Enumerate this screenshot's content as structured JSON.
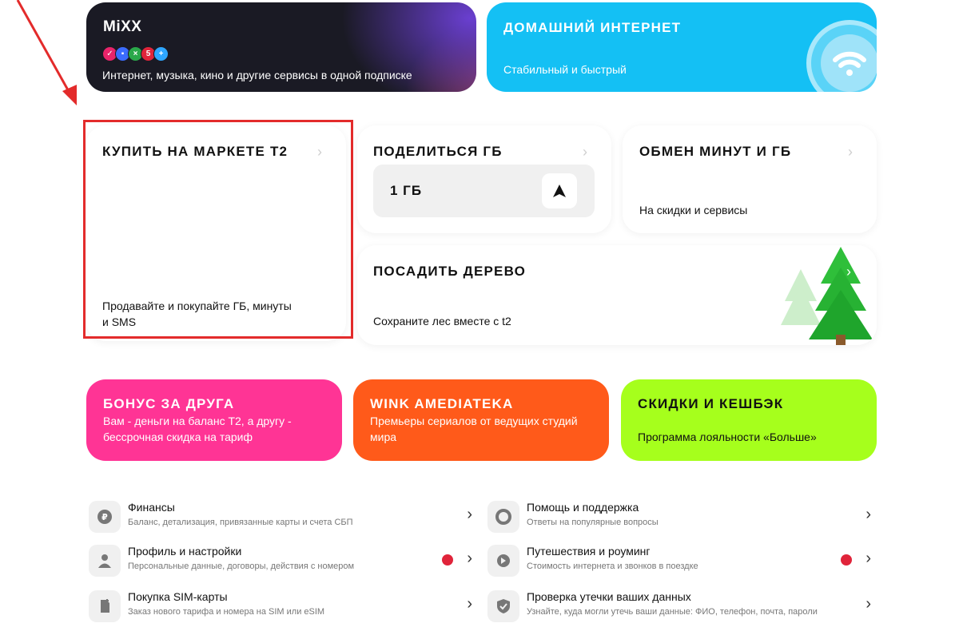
{
  "colors": {
    "accent_red": "#e32b2b",
    "home_blue": "#14c0f4",
    "bonus_pink": "#ff3495",
    "wink_orange": "#ff5a1a",
    "cashback_green": "#a6ff1c",
    "badge_red": "#e0243a"
  },
  "mixx": {
    "title": "MiXX",
    "subtitle": "Интернет, музыка, кино и другие сервисы в одной подписке",
    "service_icons": [
      "kion-icon",
      "okko-icon",
      "game-icon",
      "five-icon",
      "plus-icon"
    ]
  },
  "home_internet": {
    "title": "ДОМАШНИЙ ИНТЕРНЕТ",
    "subtitle": "Стабильный и быстрый",
    "icon": "wifi-icon"
  },
  "market": {
    "title": "КУПИТЬ НА МАРКЕТЕ t2",
    "subtitle_line1": "Продавайте и покупайте ГБ, минуты",
    "subtitle_line2": "и SMS"
  },
  "share": {
    "title": "ПОДЕЛИТЬСЯ ГБ",
    "amount": "1 ГБ"
  },
  "exchange": {
    "title": "ОБМЕН МИНУТ И ГБ",
    "subtitle": "На скидки и сервисы"
  },
  "tree": {
    "title": "ПОСАДИТЬ ДЕРЕВО",
    "subtitle": "Сохраните лес вместе с t2"
  },
  "bonus": {
    "title": "БОНУС ЗА ДРУГА",
    "line1": "Вам - деньги на баланс Т2, а другу -",
    "line2": "бессрочная скидка на тариф"
  },
  "wink": {
    "title": "WINK AMEDIATEKA",
    "line1": "Премьеры сериалов от ведущих студий",
    "line2": "мира"
  },
  "cashback": {
    "title": "СКИДКИ И КЕШБЭК",
    "subtitle": "Программа лояльности «Больше»"
  },
  "menu": [
    {
      "title": "Финансы",
      "subtitle": "Баланс, детализация, привязанные карты и счета СБП",
      "icon": "ruble-icon"
    },
    {
      "title": "Помощь и поддержка",
      "subtitle": "Ответы на популярные вопросы",
      "icon": "lifebuoy-icon"
    },
    {
      "title": "Профиль и настройки",
      "subtitle": "Персональные данные, договоры, действия с номером",
      "icon": "person-icon"
    },
    {
      "title": "Путешествия и роуминг",
      "subtitle": "Стоимость интернета и звонков в поездке",
      "icon": "globe-icon"
    },
    {
      "title": "Покупка SIM-карты",
      "subtitle": "Заказ нового тарифа и номера на SIM или eSIM",
      "icon": "sim-icon"
    },
    {
      "title": "Проверка утечки ваших данных",
      "subtitle": "Узнайте, куда могли утечь ваши данные: ФИО, телефон, почта, пароли",
      "icon": "shield-icon"
    }
  ]
}
